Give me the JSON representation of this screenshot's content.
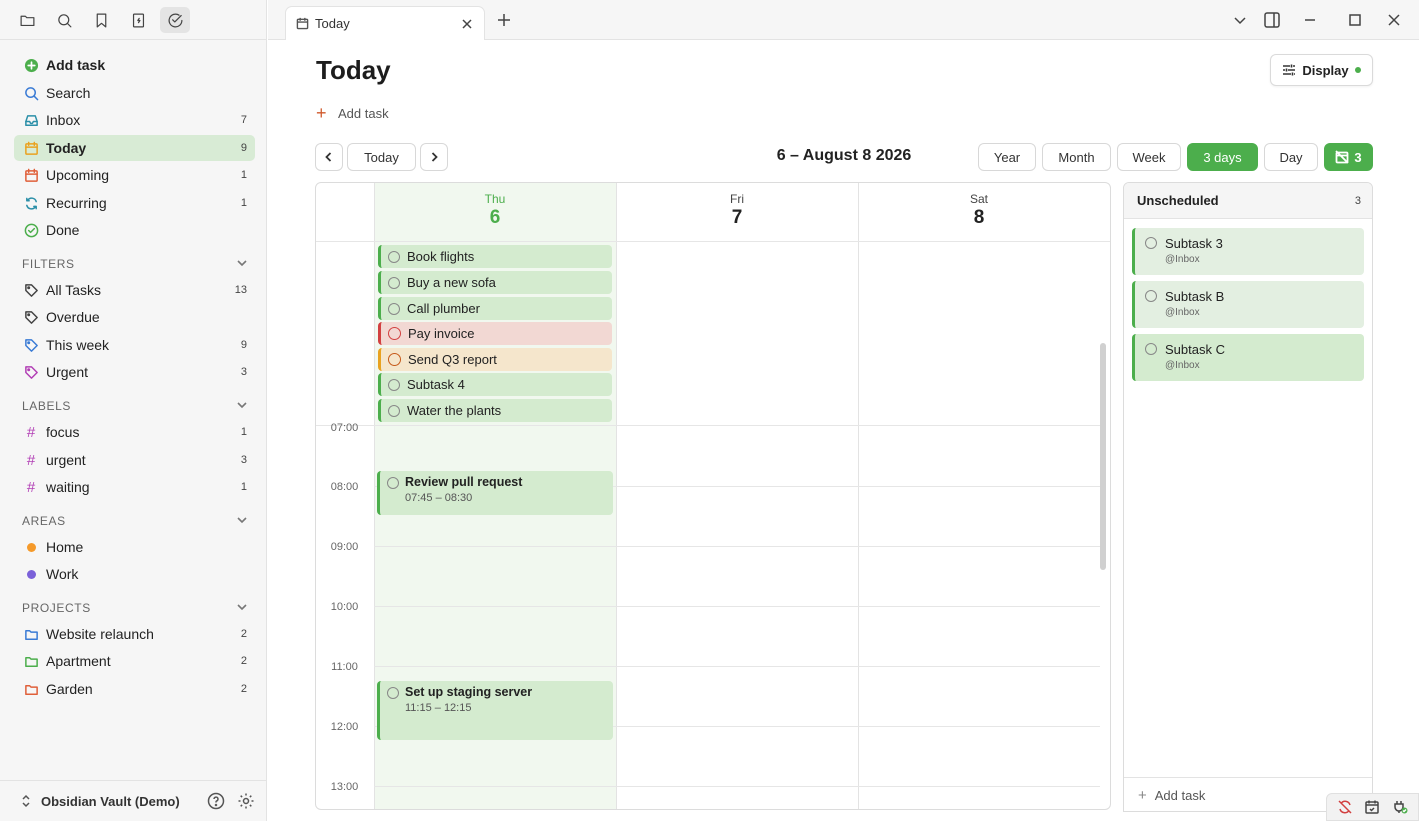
{
  "colors": {
    "accent": "#4cae4c",
    "overdue": "#d24040",
    "warning": "#e9a220",
    "label_hash": "#b23fb5",
    "area_home": "#f59a2a",
    "area_work": "#7b61d9"
  },
  "sidebar": {
    "top_icons": [
      "folder-icon",
      "search-icon",
      "bookmark-icon",
      "file-icon",
      "check-circle-icon"
    ],
    "nav": [
      {
        "label": "Add task",
        "icon": "plus-circle-icon",
        "count": ""
      },
      {
        "label": "Search",
        "icon": "search-icon",
        "count": ""
      },
      {
        "label": "Inbox",
        "icon": "inbox-icon",
        "count": "7"
      },
      {
        "label": "Today",
        "icon": "calendar-icon",
        "count": "9"
      },
      {
        "label": "Upcoming",
        "icon": "calendar-icon",
        "count": "1"
      },
      {
        "label": "Recurring",
        "icon": "repeat-icon",
        "count": "1"
      },
      {
        "label": "Done",
        "icon": "check-circle-icon",
        "count": ""
      }
    ],
    "filters_header": "FILTERS",
    "filters": [
      {
        "label": "All Tasks",
        "count": "13"
      },
      {
        "label": "Overdue",
        "count": ""
      },
      {
        "label": "This week",
        "count": "9"
      },
      {
        "label": "Urgent",
        "count": "3"
      }
    ],
    "labels_header": "LABELS",
    "labels": [
      {
        "label": "focus",
        "count": "1"
      },
      {
        "label": "urgent",
        "count": "3"
      },
      {
        "label": "waiting",
        "count": "1"
      }
    ],
    "areas_header": "AREAS",
    "areas": [
      {
        "label": "Home"
      },
      {
        "label": "Work"
      }
    ],
    "projects_header": "PROJECTS",
    "projects": [
      {
        "label": "Website relaunch",
        "count": "2"
      },
      {
        "label": "Apartment",
        "count": "2"
      },
      {
        "label": "Garden",
        "count": "2"
      }
    ],
    "vault_name": "Obsidian Vault (Demo)"
  },
  "tab": {
    "title": "Today"
  },
  "main": {
    "title": "Today",
    "display_label": "Display",
    "add_task_label": "Add task",
    "today_button": "Today",
    "date_range": "6 – August 8 2026",
    "views": [
      "Year",
      "Month",
      "Week",
      "3 days",
      "Day"
    ],
    "active_view": "3 days",
    "unscheduled_toggle_count": "3"
  },
  "calendar": {
    "days": [
      {
        "name": "Thu",
        "num": "6",
        "today": true
      },
      {
        "name": "Fri",
        "num": "7",
        "today": false
      },
      {
        "name": "Sat",
        "num": "8",
        "today": false
      }
    ],
    "all_day_tasks": [
      {
        "title": "Book flights",
        "status": "normal"
      },
      {
        "title": "Buy a new sofa",
        "status": "normal"
      },
      {
        "title": "Call plumber",
        "status": "normal"
      },
      {
        "title": "Pay invoice",
        "status": "overdue"
      },
      {
        "title": "Send Q3 report",
        "status": "warning"
      },
      {
        "title": "Subtask 4",
        "status": "normal"
      },
      {
        "title": "Water the plants",
        "status": "normal"
      }
    ],
    "hours": [
      "07:00",
      "08:00",
      "09:00",
      "10:00",
      "11:00",
      "12:00",
      "13:00"
    ],
    "timed_tasks": [
      {
        "title": "Review pull request",
        "time": "07:45 – 08:30",
        "start": 7.75,
        "end": 8.5
      },
      {
        "title": "Set up staging server",
        "time": "11:15 – 12:15",
        "start": 11.25,
        "end": 12.25
      }
    ]
  },
  "unscheduled": {
    "title": "Unscheduled",
    "count": "3",
    "items": [
      {
        "title": "Subtask 3",
        "project": "@Inbox"
      },
      {
        "title": "Subtask B",
        "project": "@Inbox"
      },
      {
        "title": "Subtask C",
        "project": "@Inbox"
      }
    ],
    "add_label": "Add task"
  },
  "status_bar": {
    "icons": [
      "sync-off-icon",
      "calendar-sync-icon",
      "plugin-ok-icon"
    ]
  }
}
